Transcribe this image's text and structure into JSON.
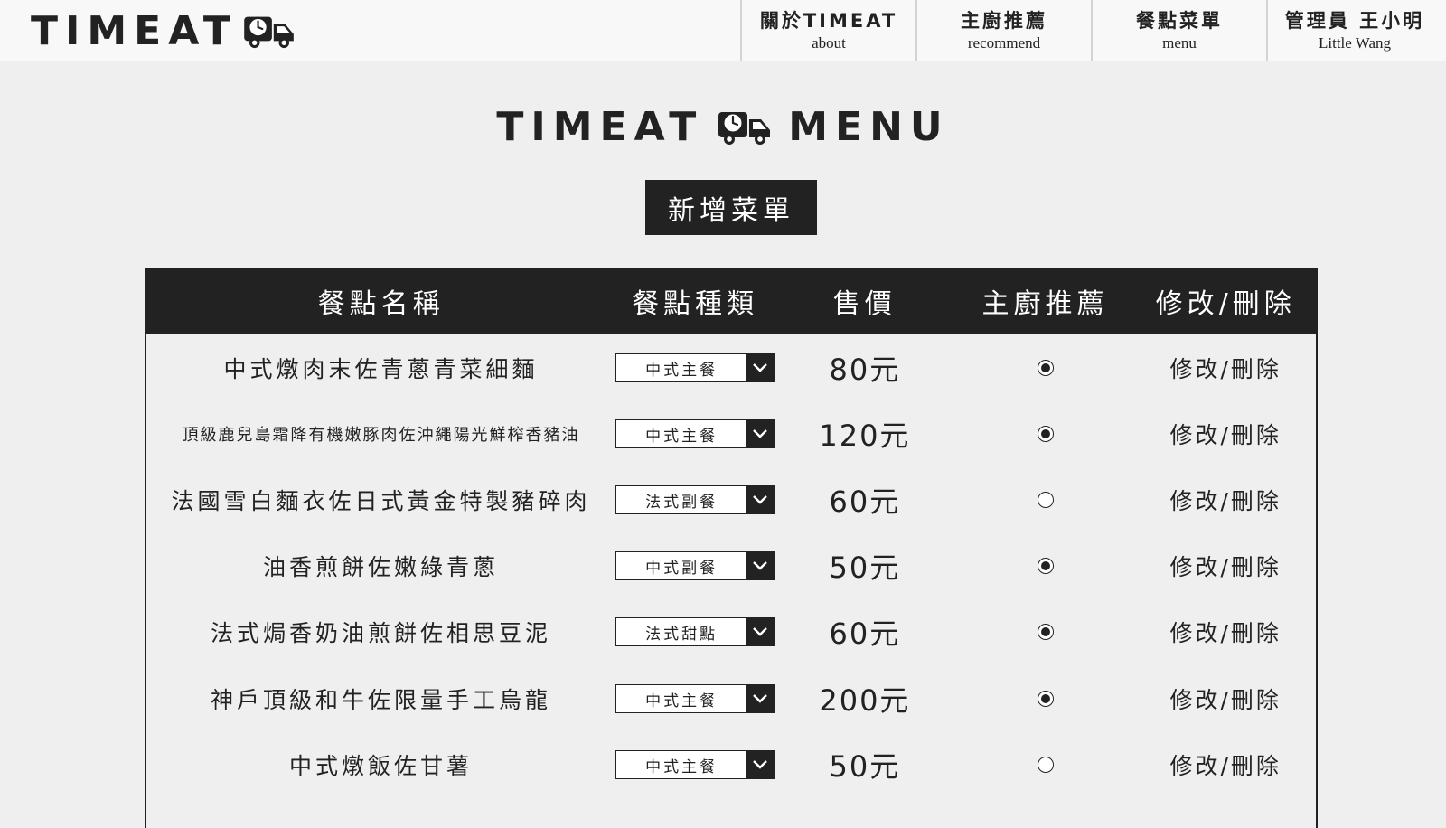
{
  "header": {
    "logo_text": "TIMEAT",
    "nav": [
      {
        "zh": "關於TIMEAT",
        "en": "about"
      },
      {
        "zh": "主廚推薦",
        "en": "recommend"
      },
      {
        "zh": "餐點菜單",
        "en": "menu"
      },
      {
        "zh": "管理員 王小明",
        "en": "Little Wang"
      }
    ]
  },
  "page": {
    "title_left": "TIMEAT",
    "title_right": "MENU",
    "add_button": "新增菜單"
  },
  "table": {
    "headers": [
      "餐點名稱",
      "餐點種類",
      "售價",
      "主廚推薦",
      "修改/刪除"
    ],
    "action_label": "修改/刪除",
    "rows": [
      {
        "name": "中式燉肉末佐青蔥青菜細麵",
        "type": "中式主餐",
        "price": "80元",
        "recommended": true
      },
      {
        "name": "頂級鹿兒島霜降有機嫩豚肉佐沖繩陽光鮮榨香豬油",
        "type": "中式主餐",
        "price": "120元",
        "recommended": true
      },
      {
        "name": "法國雪白麵衣佐日式黃金特製豬碎肉",
        "type": "法式副餐",
        "price": "60元",
        "recommended": false
      },
      {
        "name": "油香煎餅佐嫩綠青蔥",
        "type": "中式副餐",
        "price": "50元",
        "recommended": true
      },
      {
        "name": "法式焗香奶油煎餅佐相思豆泥",
        "type": "法式甜點",
        "price": "60元",
        "recommended": true
      },
      {
        "name": "神戶頂級和牛佐限量手工烏龍",
        "type": "中式主餐",
        "price": "200元",
        "recommended": true
      },
      {
        "name": "中式燉飯佐甘薯",
        "type": "中式主餐",
        "price": "50元",
        "recommended": false
      }
    ]
  },
  "icons": {
    "truck": "truck-clock-icon",
    "select_arrow": "chevron-down-icon"
  }
}
